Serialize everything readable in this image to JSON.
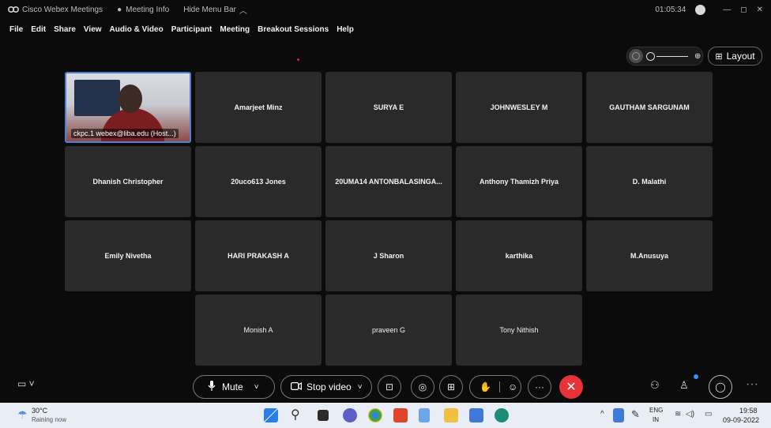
{
  "titlebar": {
    "app_title": "Cisco Webex Meetings",
    "meeting_info": "Meeting Info",
    "hide_menu": "Hide Menu Bar",
    "timer": "01:05:34"
  },
  "menu": [
    "File",
    "Edit",
    "Share",
    "View",
    "Audio & Video",
    "Participant",
    "Meeting",
    "Breakout Sessions",
    "Help"
  ],
  "layout_label": "Layout",
  "tiles": [
    {
      "name": "ckpc.1 webex@liba.edu (Host...)",
      "host": true
    },
    {
      "name": "Amarjeet Minz"
    },
    {
      "name": "SURYA E"
    },
    {
      "name": "JOHNWESLEY M"
    },
    {
      "name": "GAUTHAM SARGUNAM"
    },
    {
      "name": "Dhanish Christopher"
    },
    {
      "name": "20uco613 Jones"
    },
    {
      "name": "20UMA14 ANTONBALASINGA..."
    },
    {
      "name": "Anthony Thamizh Priya"
    },
    {
      "name": "D. Malathi"
    },
    {
      "name": "Emily Nivetha"
    },
    {
      "name": "HARI PRAKASH A"
    },
    {
      "name": "J Sharon"
    },
    {
      "name": "karthika"
    },
    {
      "name": "M.Anusuya"
    },
    {
      "name": "Monish A",
      "plain": true
    },
    {
      "name": "praveen G",
      "plain": true
    },
    {
      "name": "Tony Nithish",
      "plain": true
    }
  ],
  "controls": {
    "mute": "Mute",
    "stop_video": "Stop video"
  },
  "taskbar": {
    "temp": "30°C",
    "weather": "Raining now",
    "lang": "ENG",
    "region": "IN",
    "time": "19:58",
    "date": "09-09-2022"
  }
}
